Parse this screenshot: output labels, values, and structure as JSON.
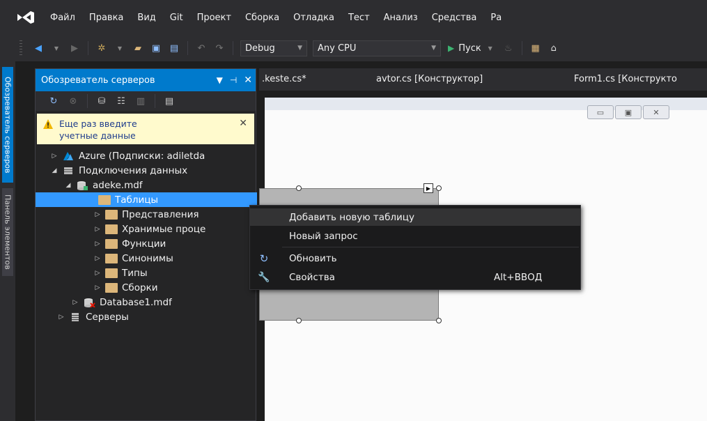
{
  "menu": {
    "items": [
      "Файл",
      "Правка",
      "Вид",
      "Git",
      "Проект",
      "Сборка",
      "Отладка",
      "Тест",
      "Анализ",
      "Средства",
      "Ра"
    ]
  },
  "toolbar": {
    "config": "Debug",
    "platform": "Any CPU",
    "run_label": "Пуск"
  },
  "side_strip": {
    "server_explorer": "Обозреватель серверов",
    "toolbox": "Панель элементов"
  },
  "server_explorer": {
    "title": "Обозреватель серверов",
    "warning": [
      "Еще раз введите",
      "учетные данные"
    ],
    "tree": {
      "azure": "Azure (Подписки: adiletda",
      "data_connections": "Подключения данных",
      "adeke": "adeke.mdf",
      "tables": "Таблицы",
      "views": "Представления",
      "procedures": "Хранимые проце",
      "functions": "Функции",
      "synonyms": "Синонимы",
      "types": "Типы",
      "assemblies": "Сборки",
      "database1": "Database1.mdf",
      "servers": "Серверы"
    }
  },
  "document_tabs": [
    ".keste.cs*",
    "avtor.cs [Конструктор]",
    "Form1.cs [Конструкто"
  ],
  "context_menu": {
    "add_table": "Добавить новую таблицу",
    "new_query": "Новый запрос",
    "refresh": "Обновить",
    "properties": "Свойства",
    "properties_shortcut": "Alt+ВВОД"
  },
  "colors": {
    "accent": "#007acc",
    "selection": "#3399ff",
    "warning_bg": "#fffacd"
  }
}
